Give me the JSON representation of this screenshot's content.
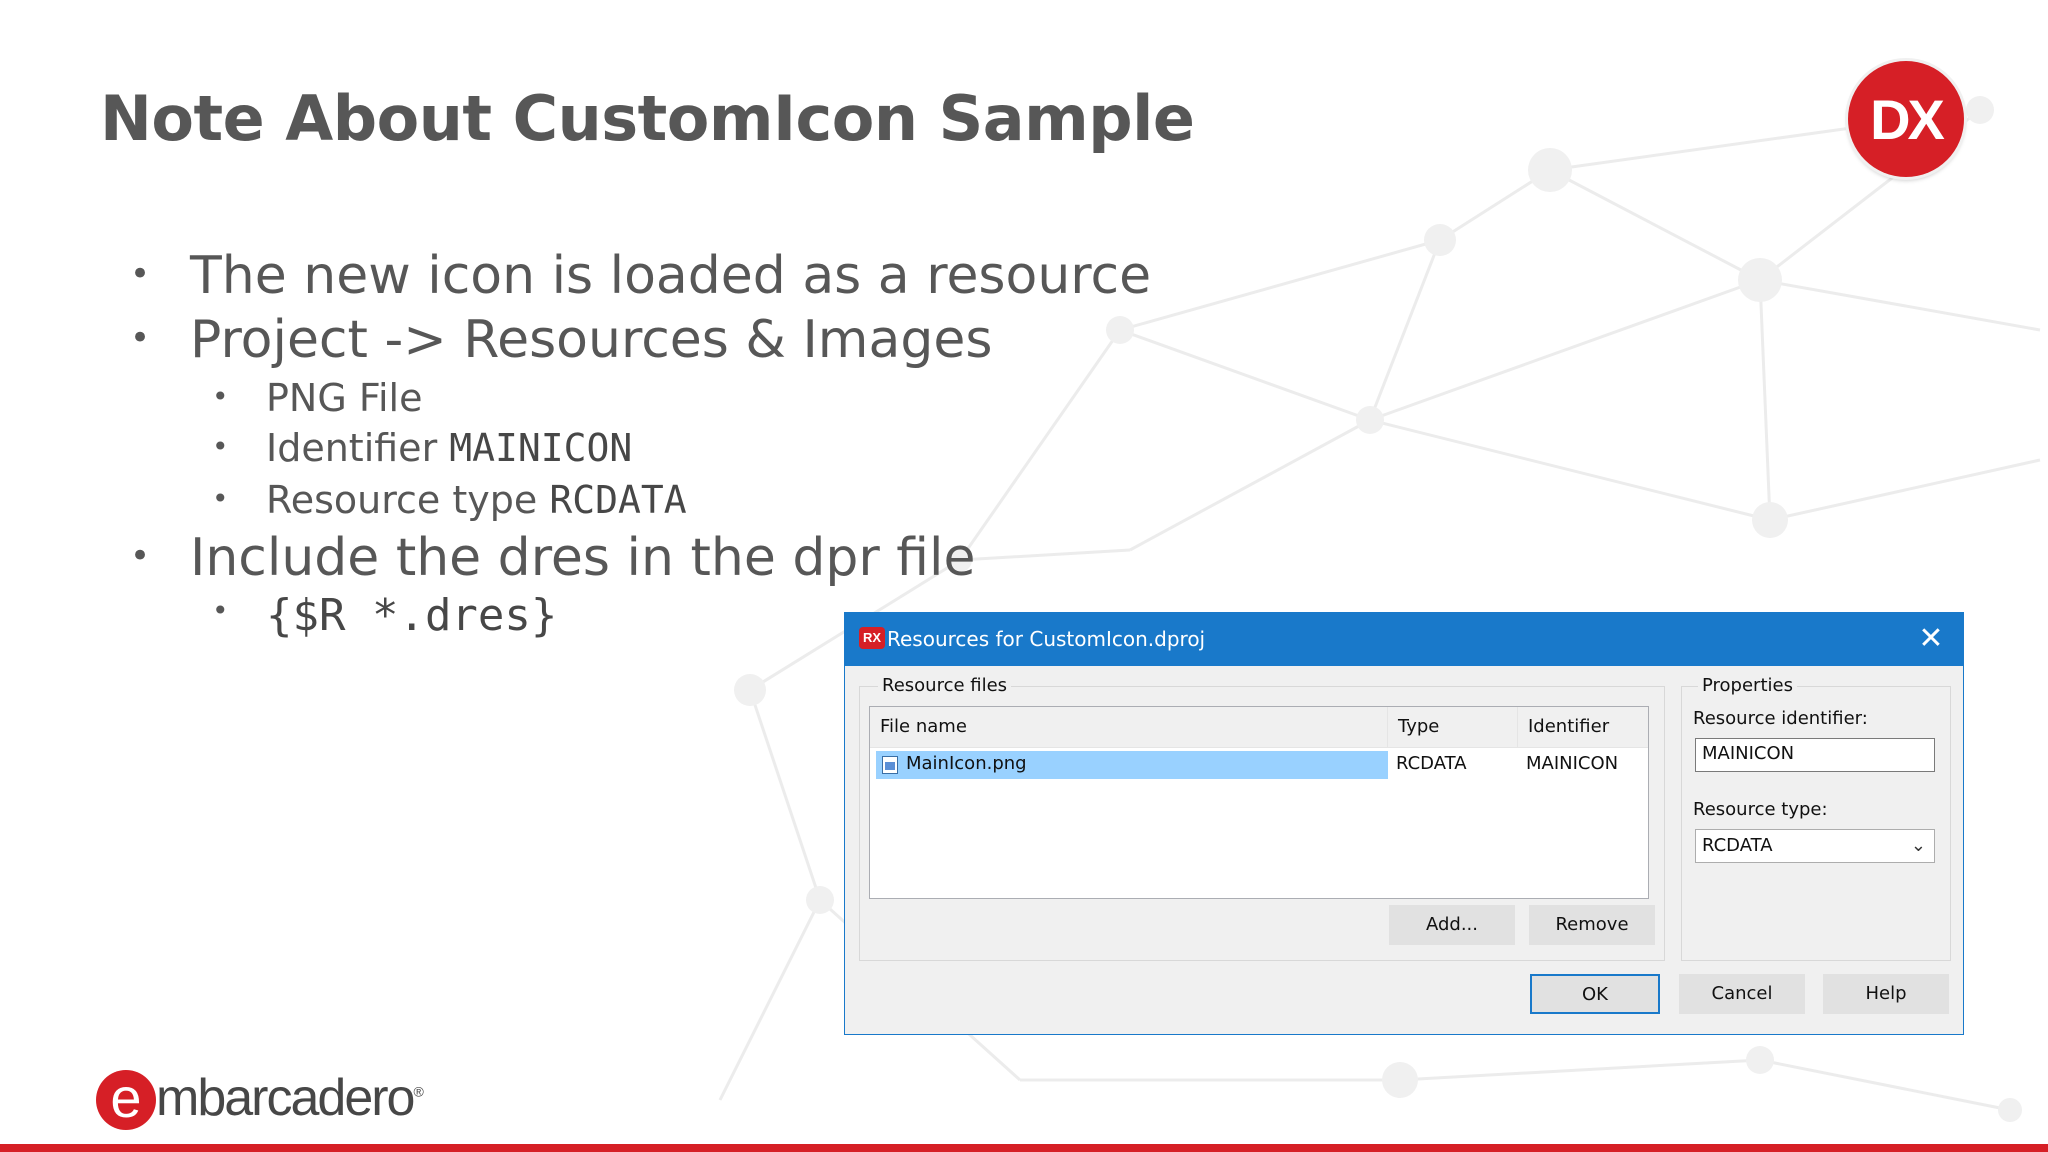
{
  "slide": {
    "title": "Note About CustomIcon Sample",
    "bullets": [
      "The new icon is loaded as a resource",
      "Project -> Resources & Images",
      "PNG File",
      "Identifier ",
      "MAINICON",
      "Resource type ",
      "RCDATA",
      "Include the dres in the dpr file",
      "{$R *.dres}"
    ],
    "dx_logo": "DX",
    "brand": {
      "e": "e",
      "rest": "mbarcadero",
      "reg": "®"
    },
    "colors": {
      "brand_red": "#d61f26",
      "title_gray": "#575757",
      "dialog_blue": "#1979ca"
    }
  },
  "dialog": {
    "app_icon": "RX",
    "title": "Resources for CustomIcon.dproj",
    "close_glyph": "✕",
    "resource_files_label": "Resource files",
    "columns": [
      "File name",
      "Type",
      "Identifier"
    ],
    "rows": [
      {
        "file": "MainIcon.png",
        "type": "RCDATA",
        "identifier": "MAINICON"
      }
    ],
    "add_label": "Add...",
    "remove_label": "Remove",
    "properties_label": "Properties",
    "resource_identifier_label": "Resource identifier:",
    "resource_identifier_value": "MAINICON",
    "resource_type_label": "Resource type:",
    "resource_type_value": "RCDATA",
    "ok_label": "OK",
    "cancel_label": "Cancel",
    "help_label": "Help"
  }
}
